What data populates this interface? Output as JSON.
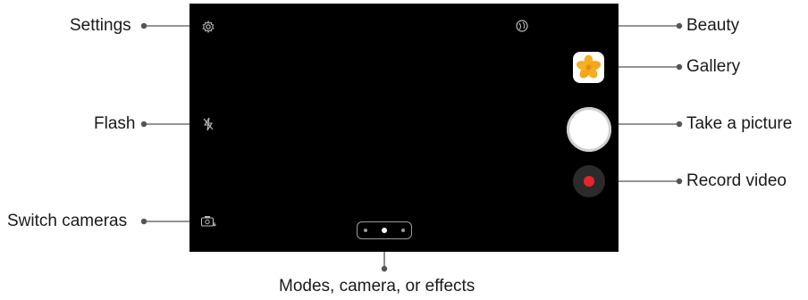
{
  "callouts": {
    "settings": "Settings",
    "flash": "Flash",
    "switch_cameras": "Switch cameras",
    "beauty": "Beauty",
    "gallery": "Gallery",
    "take_picture": "Take a picture",
    "record_video": "Record video",
    "modes": "Modes, camera, or effects"
  },
  "icons": {
    "settings": "gear-icon",
    "flash": "flash-off-icon",
    "switch_cameras": "switch-camera-icon",
    "beauty": "beauty-icon",
    "gallery": "gallery-thumbnail-icon"
  },
  "mode_indicator": {
    "dots": 3,
    "active_index": 1
  },
  "colors": {
    "screen": "#000000",
    "record_dot": "#e8242a",
    "callout_line": "#555555",
    "gallery_star": "#f5b021"
  }
}
